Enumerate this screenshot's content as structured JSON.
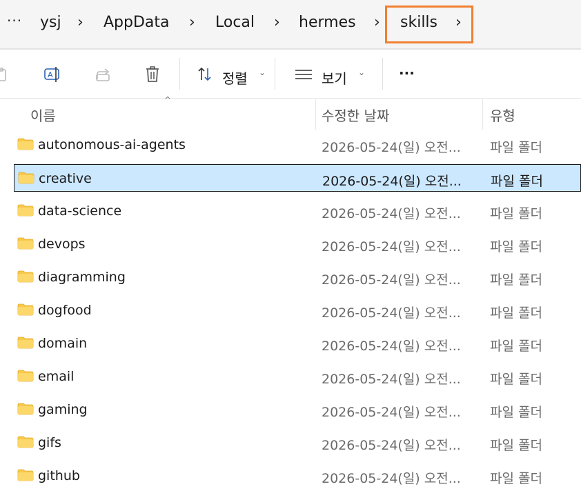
{
  "breadcrumb": {
    "more": "···",
    "items": [
      "ysj",
      "AppData",
      "Local",
      "hermes",
      "skills"
    ]
  },
  "toolbar": {
    "sort_label": "정렬",
    "view_label": "보기",
    "more_label": "···"
  },
  "columns": {
    "name": "이름",
    "date": "수정한 날짜",
    "type": "유형"
  },
  "rows": [
    {
      "name": "autonomous-ai-agents",
      "date": "2026-05-24(일) 오전...",
      "type": "파일 폴더"
    },
    {
      "name": "creative",
      "date": "2026-05-24(일) 오전...",
      "type": "파일 폴더",
      "selected": true
    },
    {
      "name": "data-science",
      "date": "2026-05-24(일) 오전...",
      "type": "파일 폴더"
    },
    {
      "name": "devops",
      "date": "2026-05-24(일) 오전...",
      "type": "파일 폴더"
    },
    {
      "name": "diagramming",
      "date": "2026-05-24(일) 오전...",
      "type": "파일 폴더"
    },
    {
      "name": "dogfood",
      "date": "2026-05-24(일) 오전...",
      "type": "파일 폴더"
    },
    {
      "name": "domain",
      "date": "2026-05-24(일) 오전...",
      "type": "파일 폴더"
    },
    {
      "name": "email",
      "date": "2026-05-24(일) 오전...",
      "type": "파일 폴더"
    },
    {
      "name": "gaming",
      "date": "2026-05-24(일) 오전...",
      "type": "파일 폴더"
    },
    {
      "name": "gifs",
      "date": "2026-05-24(일) 오전...",
      "type": "파일 폴더"
    },
    {
      "name": "github",
      "date": "2026-05-24(일) 오전...",
      "type": "파일 폴더"
    }
  ],
  "colors": {
    "selection": "#cce8ff",
    "highlight_border": "#f08030",
    "folder_yellow": "#f8c94a"
  }
}
